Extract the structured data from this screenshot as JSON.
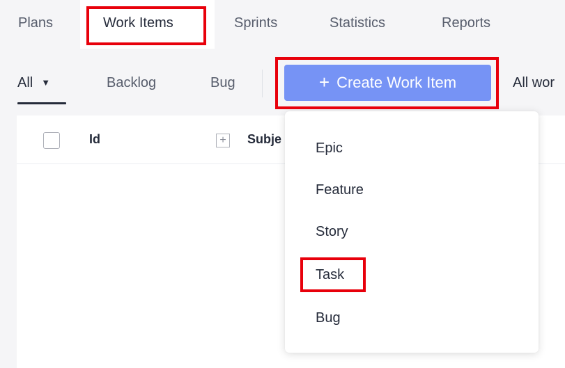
{
  "tabs": [
    {
      "label": "Plans"
    },
    {
      "label": "Work Items"
    },
    {
      "label": "Sprints"
    },
    {
      "label": "Statistics"
    },
    {
      "label": "Reports"
    }
  ],
  "filters": {
    "all_label": "All",
    "backlog_label": "Backlog",
    "bug_label": "Bug"
  },
  "create_button": {
    "icon": "plus-icon",
    "label": "Create Work Item"
  },
  "all_work_label": "All wor",
  "table": {
    "columns": [
      {
        "label": "Id"
      },
      {
        "label": "Subje"
      }
    ]
  },
  "menu": {
    "items": [
      {
        "label": "Epic"
      },
      {
        "label": "Feature"
      },
      {
        "label": "Story"
      },
      {
        "label": "Task"
      },
      {
        "label": "Bug"
      }
    ]
  },
  "colors": {
    "accent": "#7693f5",
    "highlight": "#e8000b"
  }
}
